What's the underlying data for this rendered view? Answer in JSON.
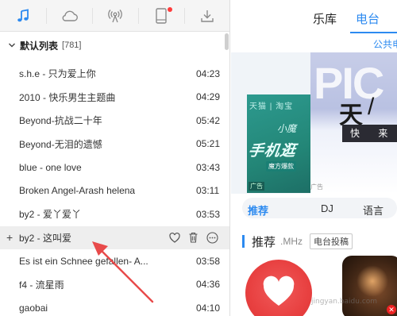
{
  "left_tabs": [
    {
      "name": "music",
      "icon": "music-note-icon",
      "active": true
    },
    {
      "name": "cloud",
      "icon": "cloud-icon"
    },
    {
      "name": "radio",
      "icon": "radio-antenna-icon"
    },
    {
      "name": "device",
      "icon": "phone-device-icon",
      "has_notification_dot": true
    },
    {
      "name": "download",
      "icon": "download-icon"
    }
  ],
  "playlist": {
    "title": "默认列表",
    "count": "[781]",
    "songs": [
      {
        "title": "s.h.e - 只为爱上你",
        "duration": "04:23"
      },
      {
        "title": "2010 - 快乐男生主题曲",
        "duration": "04:29"
      },
      {
        "title": "Beyond-抗战二十年",
        "duration": "05:42"
      },
      {
        "title": "Beyond-无泪的遗憾",
        "duration": "05:21"
      },
      {
        "title": "blue - one love",
        "duration": "03:43"
      },
      {
        "title": "Broken Angel-Arash helena",
        "duration": "03:11"
      },
      {
        "title": "by2 - 爱丫爱丫",
        "duration": "03:53"
      },
      {
        "title": "by2 - 这叫爱",
        "duration": "",
        "active": true
      },
      {
        "title": "Es ist ein Schnee gefallen- A...",
        "duration": "03:58"
      },
      {
        "title": "f4 - 流星雨",
        "duration": "04:36"
      },
      {
        "title": "gaobai",
        "duration": "04:10"
      }
    ]
  },
  "right": {
    "nav": {
      "library": "乐库",
      "radio": "电台"
    },
    "subnav_public": "公共电",
    "banner": {
      "left_top_text": "天猫 | 淘宝",
      "left_mini_text": "小魔",
      "left_big_text": "手机逛",
      "left_tag_text": "魔方爆款",
      "left_ad": "广告",
      "main_pi": "PIC",
      "main_tian": "天",
      "main_slash": "/",
      "main_kuai": "快 来",
      "main_ad": "广告"
    },
    "categories": [
      "推荐",
      "DJ",
      "语言"
    ],
    "recommend": {
      "title": "推荐",
      "sub": ".MHz",
      "submit": "电台投稿"
    }
  },
  "watermark": "jingyan.baidu.com",
  "colors": {
    "accent": "#2c8af0",
    "active_row": "#eeeeee",
    "annotation_arrow": "#e84a4a",
    "card_red": "#e84040"
  }
}
